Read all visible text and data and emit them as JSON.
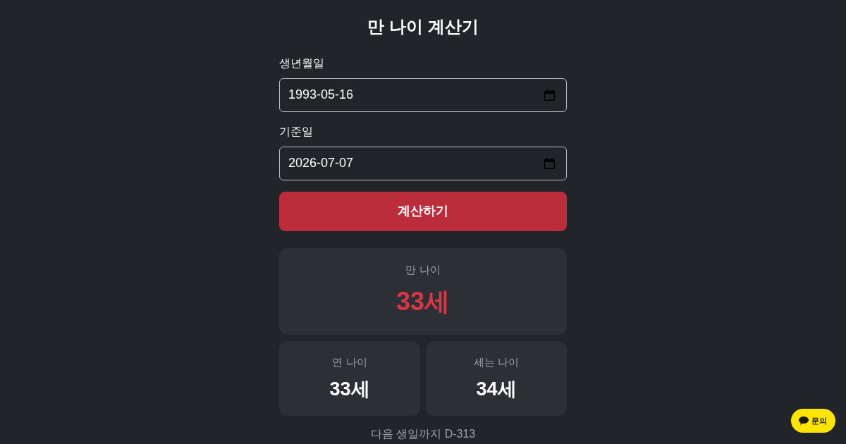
{
  "title": "만 나이 계산기",
  "fields": [
    {
      "label": "생년월일",
      "value": "1993-05-16"
    },
    {
      "label": "기준일",
      "value": "2026-07-07"
    }
  ],
  "calculate_button": "계산하기",
  "results": {
    "main": {
      "label": "만 나이",
      "value": "33세"
    },
    "secondary": [
      {
        "label": "연 나이",
        "value": "33세"
      },
      {
        "label": "세는 나이",
        "value": "34세"
      }
    ]
  },
  "next_birthday": "다음 생일까지 D-313",
  "inquiry_button": "문의"
}
